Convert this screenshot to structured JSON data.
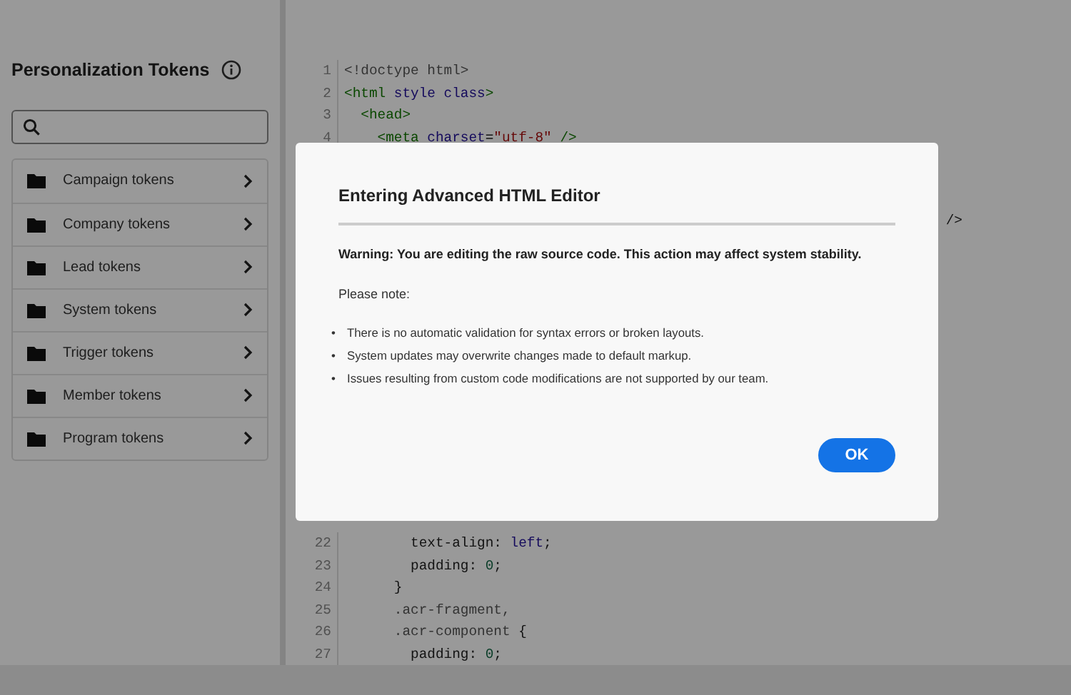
{
  "sidebar": {
    "title": "Personalization Tokens",
    "items": [
      {
        "label": "Campaign tokens"
      },
      {
        "label": "Company tokens"
      },
      {
        "label": "Lead tokens"
      },
      {
        "label": "System tokens"
      },
      {
        "label": "Trigger tokens"
      },
      {
        "label": "Member tokens"
      },
      {
        "label": "Program tokens"
      }
    ]
  },
  "editor": {
    "top_lines": [
      {
        "number": "1",
        "tokens": [
          {
            "text": "<!doctype html>",
            "kind": "meta"
          }
        ]
      },
      {
        "number": "2",
        "tokens": [
          {
            "text": "<html",
            "kind": "tag"
          },
          {
            "text": " style class",
            "kind": "attr"
          },
          {
            "text": ">",
            "kind": "tag"
          }
        ]
      },
      {
        "number": "3",
        "tokens": [
          {
            "text": "  <head>",
            "kind": "tag"
          }
        ]
      },
      {
        "number": "4",
        "tokens": [
          {
            "text": "    <meta",
            "kind": "tag"
          },
          {
            "text": " charset",
            "kind": "attr"
          },
          {
            "text": "=",
            "kind": "plain"
          },
          {
            "text": "\"utf-8\"",
            "kind": "string"
          },
          {
            "text": " />",
            "kind": "tag"
          }
        ]
      }
    ],
    "hidden_fragment": "/>",
    "bottom_lines": [
      {
        "number": "22",
        "tokens": [
          {
            "text": "        text-align: ",
            "kind": "plain"
          },
          {
            "text": "left",
            "kind": "attr"
          },
          {
            "text": ";",
            "kind": "plain"
          }
        ]
      },
      {
        "number": "23",
        "tokens": [
          {
            "text": "        padding: ",
            "kind": "plain"
          },
          {
            "text": "0",
            "kind": "number"
          },
          {
            "text": ";",
            "kind": "plain"
          }
        ]
      },
      {
        "number": "24",
        "tokens": [
          {
            "text": "      }",
            "kind": "plain"
          }
        ]
      },
      {
        "number": "25",
        "tokens": [
          {
            "text": "      .acr-fragment,",
            "kind": "meta"
          }
        ]
      },
      {
        "number": "26",
        "tokens": [
          {
            "text": "      .acr-component",
            "kind": "meta"
          },
          {
            "text": " {",
            "kind": "plain"
          }
        ]
      },
      {
        "number": "27",
        "tokens": [
          {
            "text": "        padding: ",
            "kind": "plain"
          },
          {
            "text": "0",
            "kind": "number"
          },
          {
            "text": ";",
            "kind": "plain"
          }
        ]
      }
    ]
  },
  "dialog": {
    "title": "Entering Advanced HTML Editor",
    "warning": "Warning: You are editing the raw source code. This action may affect system stability.",
    "note": "Please note:",
    "bullets": [
      {
        "marker": "•",
        "text": "There is no automatic validation for syntax errors or broken layouts."
      },
      {
        "marker": "•",
        "text": "System updates may overwrite changes made to default markup."
      },
      {
        "marker": "•",
        "text": "Issues resulting from custom code modifications are not supported by our team."
      }
    ],
    "button": "OK"
  }
}
